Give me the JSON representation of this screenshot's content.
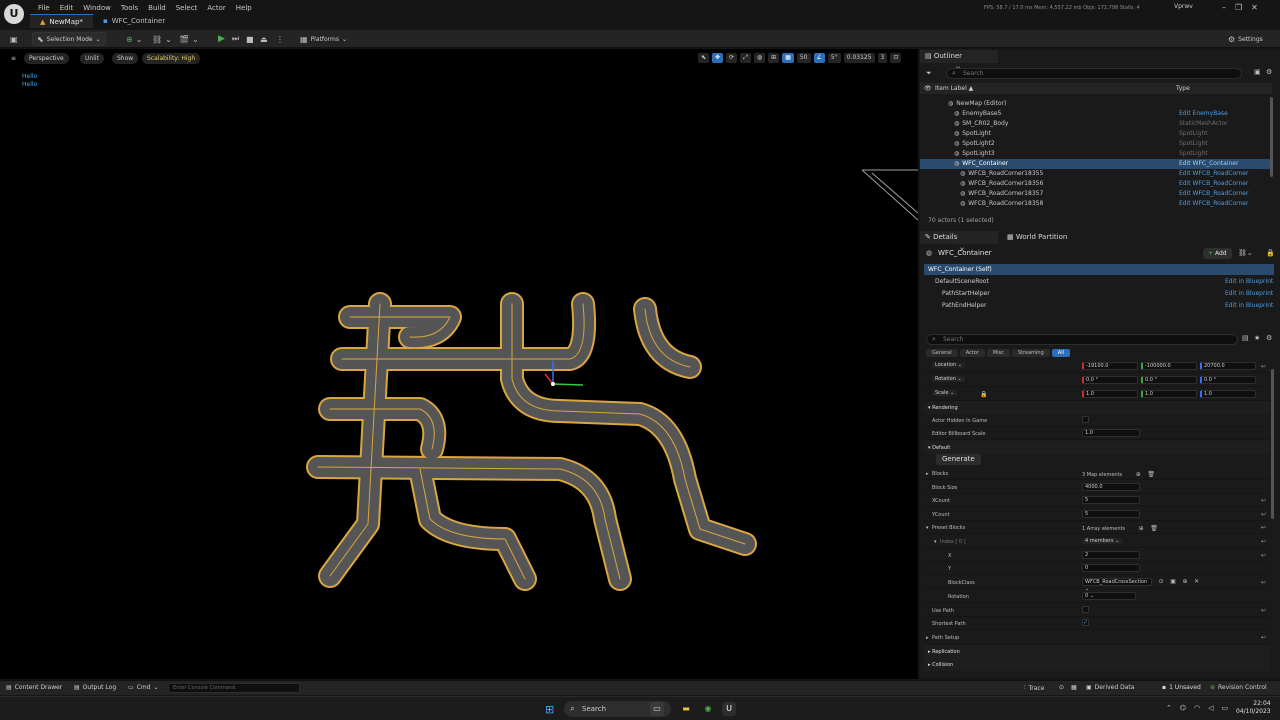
{
  "app": {
    "tabs": [
      {
        "label": "NewMap*",
        "active": true
      },
      {
        "label": "WFC_Container",
        "active": false
      }
    ],
    "menu": [
      "File",
      "Edit",
      "Window",
      "Tools",
      "Build",
      "Select",
      "Actor",
      "Help"
    ],
    "stats": "FPS: 58.7  /  17.0 ms   Mem: 4,557.22 mb   Objs: 172,798   Stalls: 4",
    "project": "Vprwv"
  },
  "toolbar": {
    "selection_mode": "Selection Mode",
    "platforms": "Platforms",
    "settings": "Settings"
  },
  "viewport": {
    "perspective": "Perspective",
    "unlit": "Unlit",
    "show": "Show",
    "scalability": "Scalability: High",
    "grid_value": "50",
    "rot_value": "5°",
    "scale_value": "0.03125",
    "camera_value": "3",
    "debug_lines": [
      "Hello",
      "Hello"
    ]
  },
  "outliner": {
    "title": "Outliner",
    "search_placeholder": "Search",
    "col_label": "Item Label ▲",
    "col_type": "Type",
    "rows": [
      {
        "label": "NewMap (Editor)",
        "type": "",
        "link": false,
        "indent": 0
      },
      {
        "label": "EnemyBase5",
        "type": "Edit EnemyBase",
        "link": true,
        "indent": 1
      },
      {
        "label": "SM_CR02_Body",
        "type": "StaticMeshActor",
        "link": false,
        "indent": 1
      },
      {
        "label": "SpotLight",
        "type": "SpotLight",
        "link": false,
        "indent": 1
      },
      {
        "label": "SpotLight2",
        "type": "SpotLight",
        "link": false,
        "indent": 1
      },
      {
        "label": "SpotLight3",
        "type": "SpotLight",
        "link": false,
        "indent": 1
      },
      {
        "label": "WFC_Container",
        "type": "Edit WFC_Container",
        "link": true,
        "indent": 1,
        "selected": true
      },
      {
        "label": "WFCB_RoadCorner18355",
        "type": "Edit WFCB_RoadCorner",
        "link": true,
        "indent": 2
      },
      {
        "label": "WFCB_RoadCorner18356",
        "type": "Edit WFCB_RoadCorner",
        "link": true,
        "indent": 2
      },
      {
        "label": "WFCB_RoadCorner18357",
        "type": "Edit WFCB_RoadCorner",
        "link": true,
        "indent": 2
      },
      {
        "label": "WFCB_RoadCorner18358",
        "type": "Edit WFCB_RoadCorner",
        "link": true,
        "indent": 2
      }
    ],
    "actor_count": "70 actors (1 selected)"
  },
  "details": {
    "tab": "Details",
    "tab2": "World Partition",
    "object_name": "WFC_Container",
    "add_label": "Add",
    "components": [
      {
        "label": "WFC_Container (Self)",
        "bp": "",
        "selected": true,
        "indent": 0
      },
      {
        "label": "DefaultSceneRoot",
        "bp": "Edit in Blueprint",
        "indent": 1
      },
      {
        "label": "PathStartHelper",
        "bp": "Edit in Blueprint",
        "indent": 2
      },
      {
        "label": "PathEndHelper",
        "bp": "Edit in Blueprint",
        "indent": 2
      }
    ],
    "search_placeholder": "Search",
    "filters": [
      "General",
      "Actor",
      "Misc",
      "Streaming",
      "All"
    ],
    "location_label": "Location",
    "location": [
      "-19100.0",
      "-100000.0",
      "20700.0"
    ],
    "rotation_label": "Rotation",
    "rotation": [
      "0.0 °",
      "0.0 °",
      "0.0 °"
    ],
    "scale_label": "Scale",
    "scale": [
      "1.0",
      "1.0",
      "1.0"
    ],
    "rendering_section": "Rendering",
    "actor_hidden_label": "Actor Hidden In Game",
    "billboard_label": "Editor Billboard Scale",
    "billboard_value": "1.0",
    "default_section": "Default",
    "generate_label": "Generate",
    "blocks_label": "Blocks",
    "blocks_value": "3 Map elements",
    "block_size_label": "Block Size",
    "block_size_value": "4000.0",
    "xcount_label": "XCount",
    "xcount_value": "5",
    "ycount_label": "YCount",
    "ycount_value": "5",
    "preset_label": "Preset Blocks",
    "preset_value": "1 Array elements",
    "index_label": "Index [ 0 ]",
    "index_value": "4 members",
    "x_label": "X",
    "x_value": "2",
    "y_label": "Y",
    "y_value": "0",
    "blockclass_label": "BlockClass",
    "blockclass_value": "WFCB_RoadCrossSection",
    "rotation2_label": "Rotation",
    "rotation2_value": "0",
    "use_path_label": "Use Path",
    "shortest_path_label": "Shortest Path",
    "path_setup": "Path Setup",
    "replication": "Replication",
    "collision": "Collision"
  },
  "bottom": {
    "content_drawer": "Content Drawer",
    "output_log": "Output Log",
    "cmd": "Cmd",
    "console_placeholder": "Enter Console Command",
    "trace": "Trace",
    "derived_data": "Derived Data",
    "unsaved": "1 Unsaved",
    "revision": "Revision Control"
  },
  "taskbar": {
    "search": "Search",
    "time": "22:04",
    "date": "04/10/2023"
  },
  "colors": {
    "accent": "#2a6fb8",
    "road_edge": "#d9a640",
    "road_fill": "#5b5b5b",
    "link": "#4c9de6"
  }
}
